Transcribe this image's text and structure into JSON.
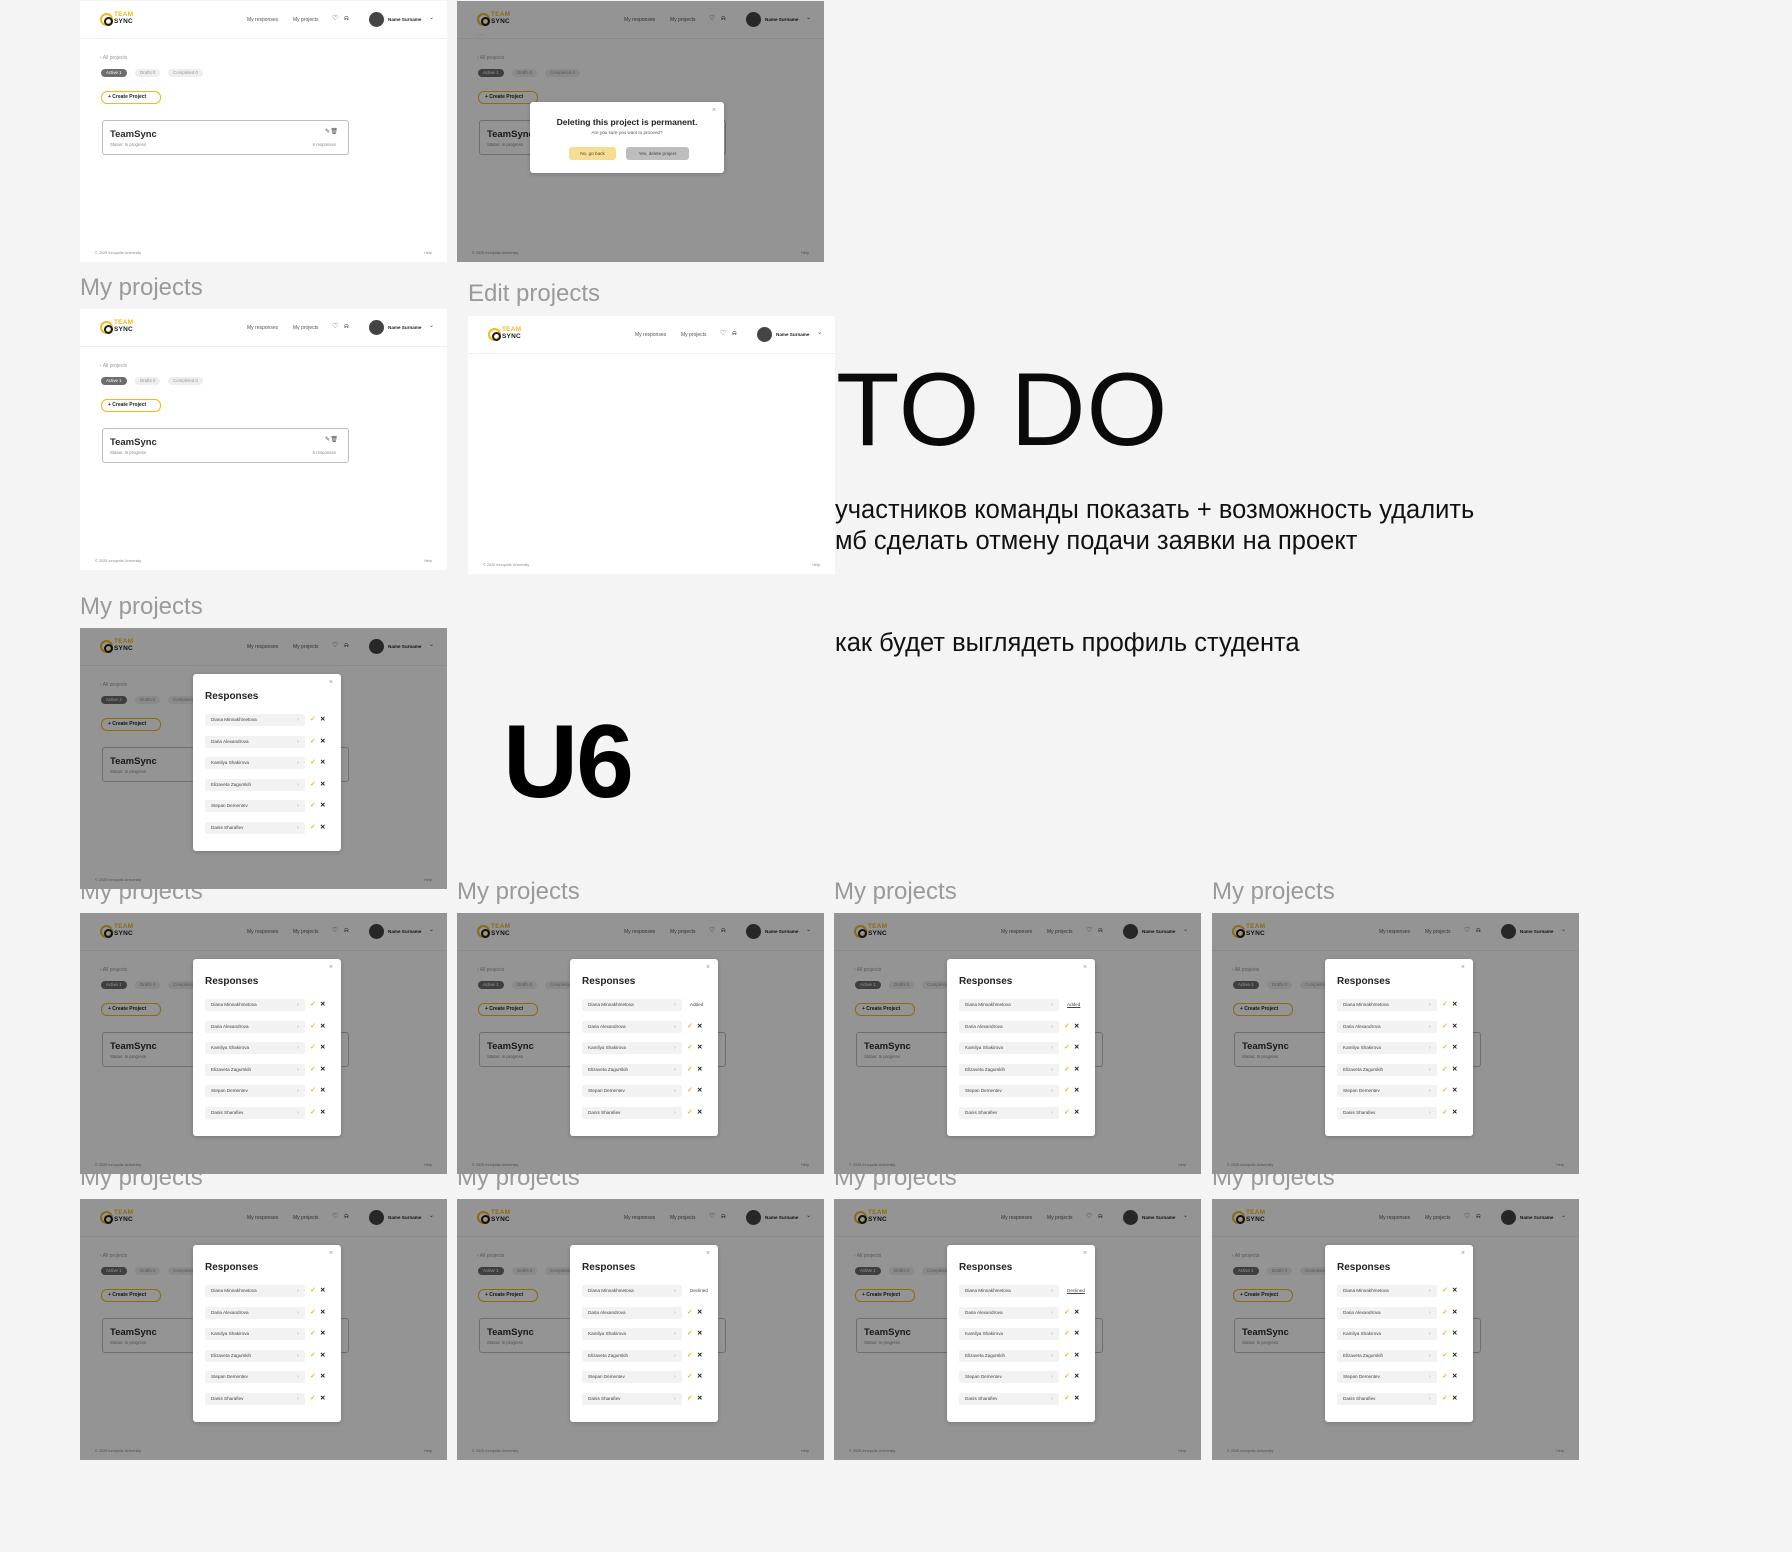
{
  "labels": {
    "f2": "My projects",
    "f4": "Edit projects",
    "f5": "My projects",
    "f6": "My projects",
    "f7": "My projects",
    "f8": "My projects",
    "f9": "My projects",
    "f10": "My projects",
    "f11": "My projects",
    "f12": "My projects",
    "f13": "My projects"
  },
  "todo": {
    "title": "TO DO",
    "line1": "участников команды показать + возможность удалить",
    "line2": "мб сделать отмену подачи заявки на проект",
    "line3": "как будет выглядеть профиль студента"
  },
  "version": "U6",
  "app": {
    "logo_top": "TEAM",
    "logo_bottom": "SYNC",
    "nav_responses": "My responses",
    "nav_projects": "My projects",
    "heart_icon": "♡",
    "bell_icon": "🔔",
    "user_name": "Name Surname",
    "caret": "⌄",
    "back": "‹   All projects",
    "tabs": [
      "Active",
      "Drafts",
      "Completed"
    ],
    "tab_counts": [
      "1",
      "0",
      "0"
    ],
    "create_label": "+   Create Project",
    "project_title": "TeamSync",
    "project_status": "Status: In progress",
    "project_responses": "6 responses",
    "footer_left": "© 2025 Innopolis University",
    "footer_right": "Help"
  },
  "delete_modal": {
    "title": "Deleting this project is permanent.",
    "subtitle": "Are you sure you want to proceed?",
    "no_label": "No, go back",
    "yes_label": "Yes, delete project"
  },
  "responses_modal": {
    "title": "Responses",
    "close": "×",
    "names": [
      "Diana Minnakhmetova",
      "Daria Alexandrova",
      "Kamilya Shakirova",
      "Elizaveta Zagurskih",
      "Stepan Dementev",
      "Danis Sharafiev"
    ],
    "accepted": "Added",
    "declined": "Declined"
  },
  "colors": {
    "accent": "#f2b81c",
    "background": "#f4f4f4",
    "overlay": "rgba(0,0,0,0.42)"
  }
}
